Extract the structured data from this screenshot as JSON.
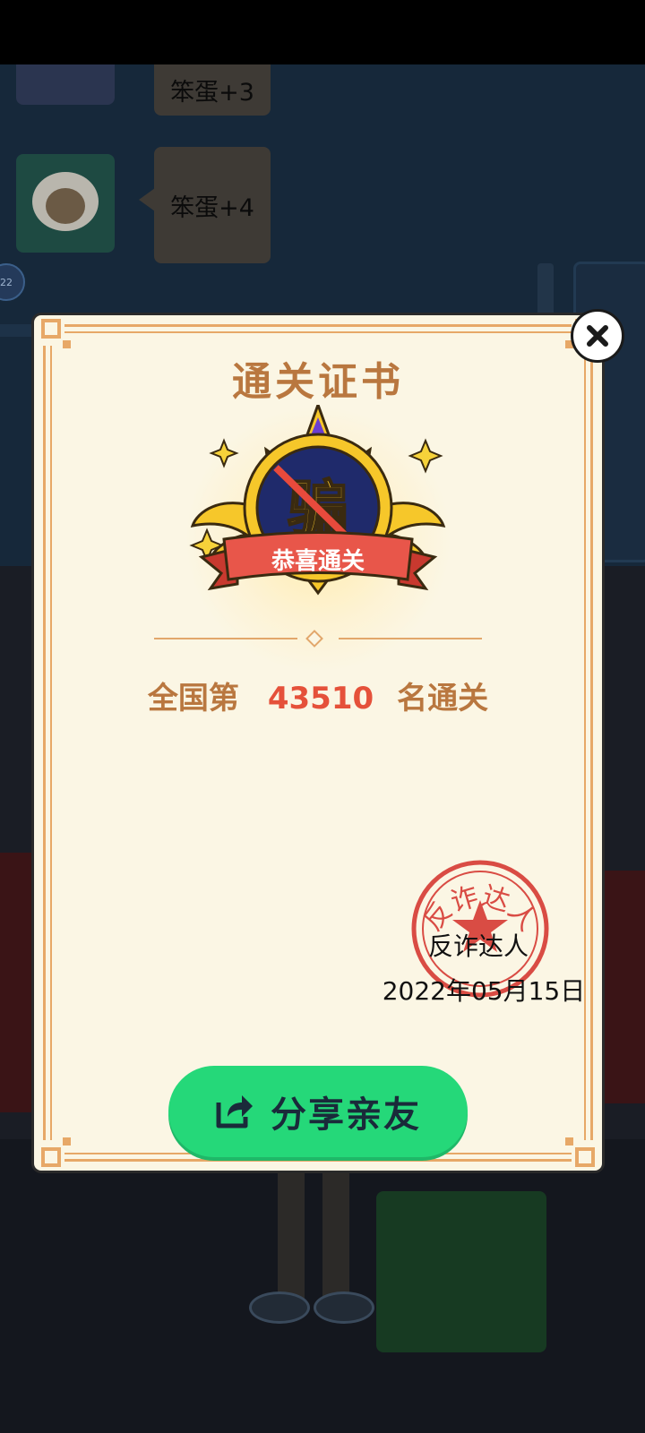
{
  "background": {
    "chat_messages": [
      {
        "text": "笨蛋+3"
      },
      {
        "text": "笨蛋+4"
      }
    ],
    "level_badge": "22"
  },
  "certificate": {
    "title": "通关证书",
    "badge_char": "骗",
    "badge_ribbon": "恭喜通关",
    "rank_prefix": "全国第",
    "rank_number": "43510",
    "rank_suffix": "名通关",
    "stamp_text": "反诈达人",
    "signer": "反诈达人",
    "date": "2022年05月15日",
    "share_label": "分享亲友",
    "share_icon": "share-icon",
    "close_icon": "close-icon"
  },
  "colors": {
    "accent_brown": "#b9773f",
    "rank_red": "#e5513a",
    "button_green": "#25d879",
    "frame_orange": "#e7a867",
    "paper": "#fbf6e4"
  }
}
